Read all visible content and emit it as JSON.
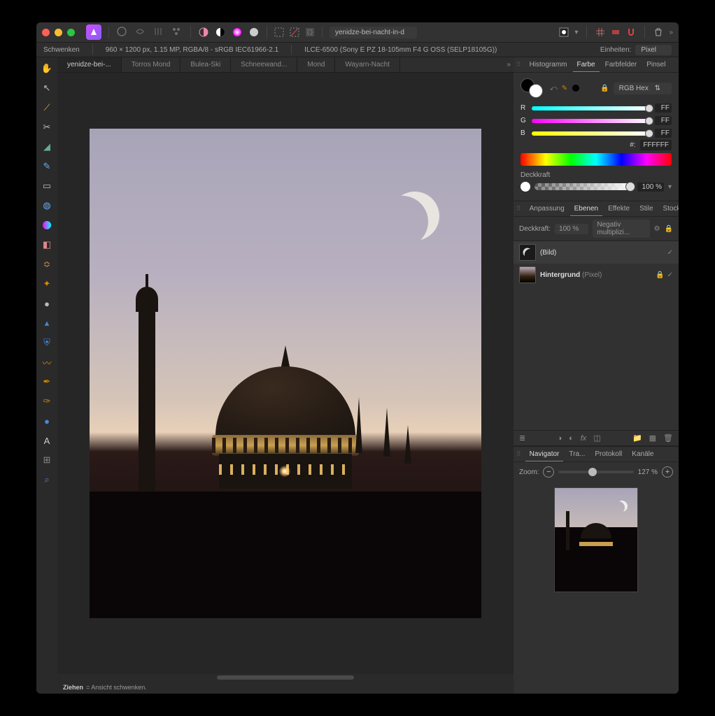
{
  "titlebar": {
    "document_select": "yenidze-bei-nacht-in-d"
  },
  "context": {
    "tool": "Schwenken",
    "dims": "960 × 1200 px, 1.15 MP, RGBA/8 - sRGB IEC61966-2.1",
    "camera": "ILCE-6500 (Sony E PZ 18-105mm F4 G OSS (SELP18105G))",
    "units_label": "Einheiten:",
    "units_value": "Pixel"
  },
  "doc_tabs": [
    "yenidze-bei-...",
    "Torros Mond",
    "Bulea-Ski",
    "Schneewand...",
    "Mond",
    "Wayarn-Nacht"
  ],
  "status": {
    "bold": "Ziehen",
    "text": " = Ansicht schwenken."
  },
  "color_panel": {
    "tabs": [
      "Histogramm",
      "Farbe",
      "Farbfelder",
      "Pinsel"
    ],
    "active_tab": 1,
    "mode": "RGB Hex",
    "r_label": "R",
    "r_val": "FF",
    "g_label": "G",
    "g_val": "FF",
    "b_label": "B",
    "b_val": "FF",
    "hex_label": "#:",
    "hex_val": "FFFFFF",
    "opacity_label": "Deckkraft",
    "opacity_val": "100 %"
  },
  "layers_panel": {
    "tabs": [
      "Anpassung",
      "Ebenen",
      "Effekte",
      "Stile",
      "Stock"
    ],
    "active_tab": 1,
    "opacity_label": "Deckkraft:",
    "opacity_val": "100 %",
    "blend_mode": "Negativ multiplizi...",
    "layers": [
      {
        "name": "(Bild)",
        "type": "",
        "locked": false,
        "visible": true
      },
      {
        "name": "Hintergrund",
        "type": "(Pixel)",
        "locked": true,
        "visible": true
      }
    ]
  },
  "nav_panel": {
    "tabs": [
      "Navigator",
      "Tra...",
      "Protokoll",
      "Kanäle"
    ],
    "active_tab": 0,
    "zoom_label": "Zoom:",
    "zoom_val": "127 %"
  }
}
